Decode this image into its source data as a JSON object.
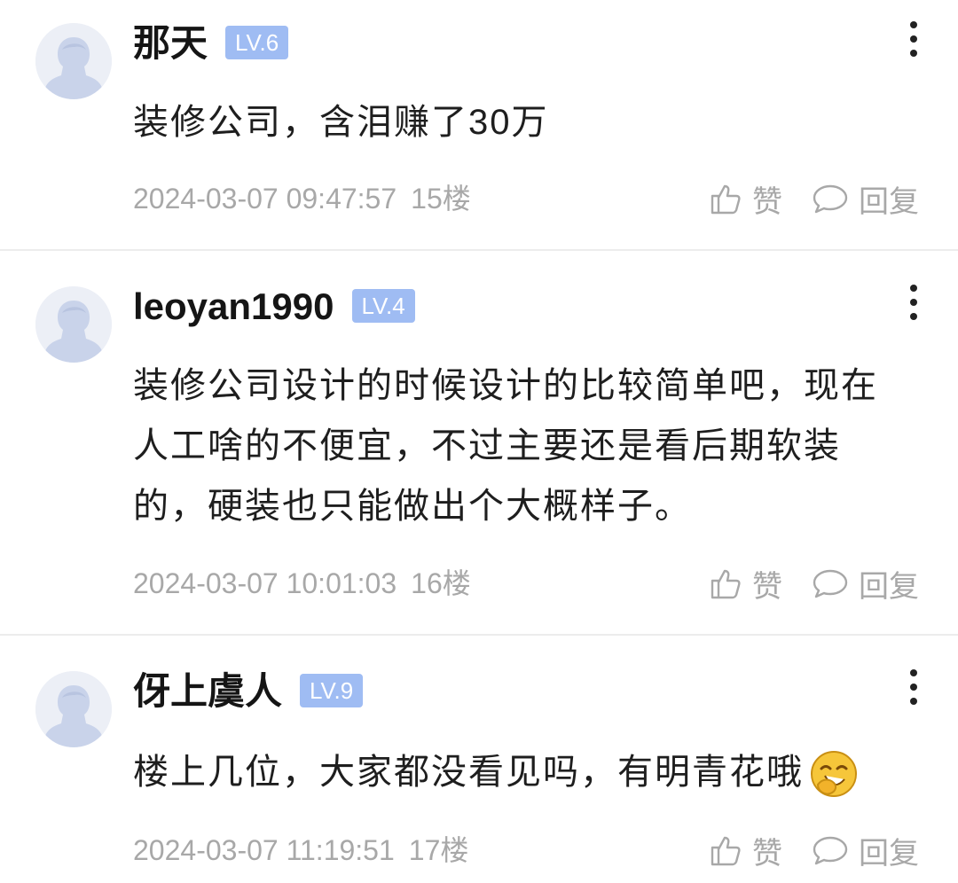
{
  "comments": [
    {
      "username": "那天",
      "level": "LV.6",
      "content": "装修公司，含泪赚了30万",
      "timestamp": "2024-03-07 09:47:57",
      "floor": "15楼",
      "like_label": "赞",
      "reply_label": "回复"
    },
    {
      "username": "leoyan1990",
      "level": "LV.4",
      "content": "装修公司设计的时候设计的比较简单吧，现在人工啥的不便宜，不过主要还是看后期软装的，硬装也只能做出个大概样子。",
      "timestamp": "2024-03-07 10:01:03",
      "floor": "16楼",
      "like_label": "赞",
      "reply_label": "回复"
    },
    {
      "username": "伢上虞人",
      "level": "LV.9",
      "content": "楼上几位，大家都没看见吗，有明青花哦",
      "timestamp": "2024-03-07 11:19:51",
      "floor": "17楼",
      "like_label": "赞",
      "reply_label": "回复",
      "emoji": "shy-laugh-emoji"
    }
  ],
  "colors": {
    "level_badge": "#9fbcf3",
    "meta_text": "#a8a8a8",
    "avatar_bg": "#eceff6",
    "avatar_figure": "#c9d3ea"
  }
}
